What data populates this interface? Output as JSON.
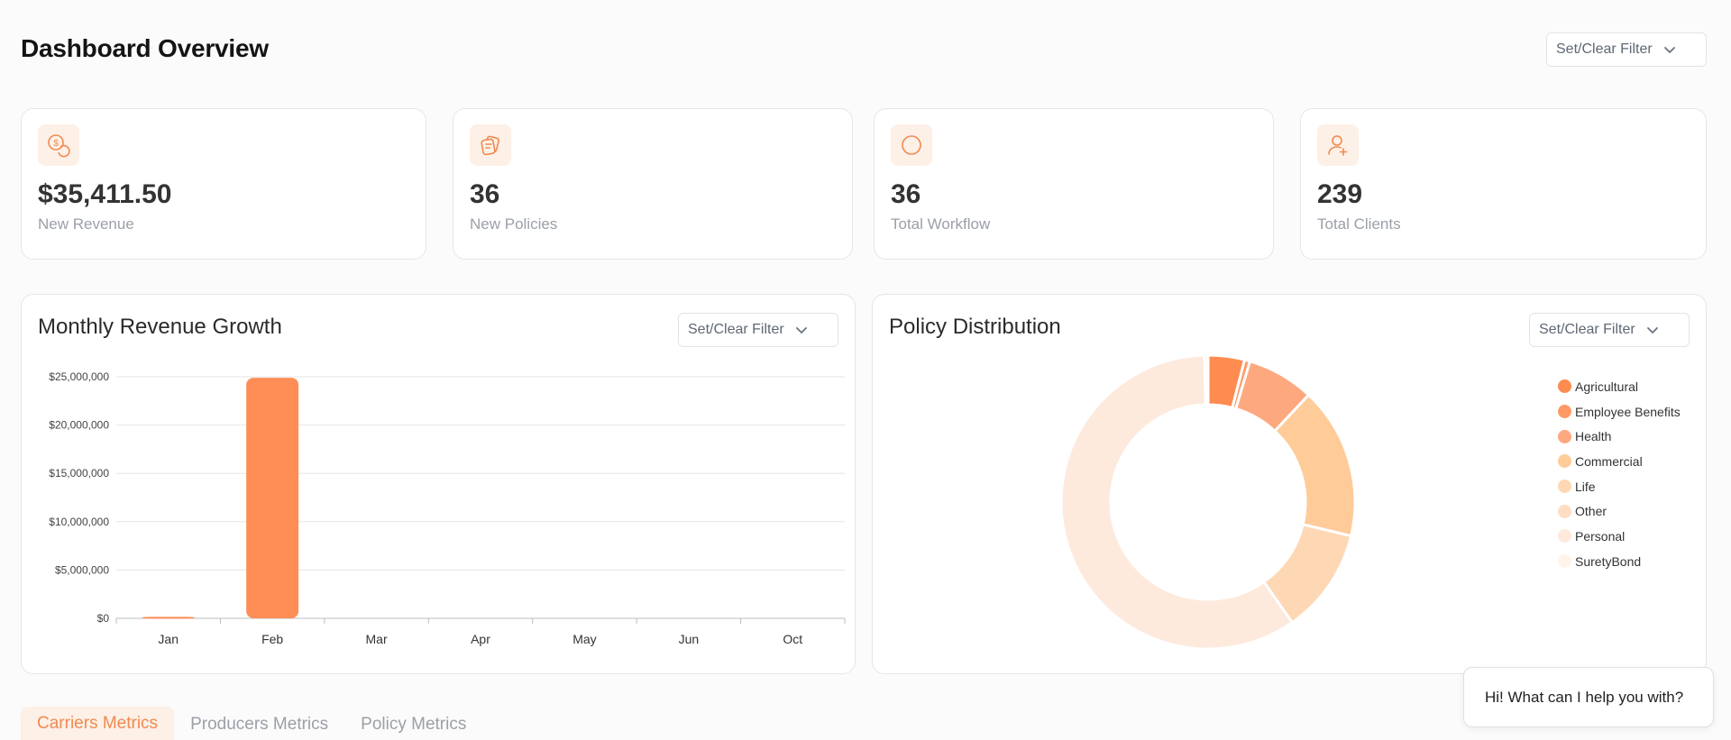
{
  "header": {
    "title": "Dashboard Overview",
    "filter_label": "Set/Clear Filter"
  },
  "stats": [
    {
      "value": "$35,411.50",
      "label": "New Revenue",
      "icon": "revenue-coins-icon"
    },
    {
      "value": "36",
      "label": "New Policies",
      "icon": "policies-icon"
    },
    {
      "value": "36",
      "label": "Total Workflow",
      "icon": "workflow-circle-icon"
    },
    {
      "value": "239",
      "label": "Total Clients",
      "icon": "add-user-icon"
    }
  ],
  "revenue_panel": {
    "title": "Monthly Revenue Growth",
    "filter_label": "Set/Clear Filter"
  },
  "policy_panel": {
    "title": "Policy Distribution",
    "filter_label": "Set/Clear Filter"
  },
  "tabs": [
    {
      "label": "Carriers Metrics",
      "active": true
    },
    {
      "label": "Producers Metrics",
      "active": false
    },
    {
      "label": "Policy Metrics",
      "active": false
    }
  ],
  "chat": {
    "message": "Hi! What can I help you with?"
  },
  "colors": {
    "accent": "#f08a50",
    "bar": "#fe8e55"
  },
  "chart_data": [
    {
      "type": "bar",
      "categories": [
        "Jan",
        "Feb",
        "Mar",
        "Apr",
        "May",
        "Jun",
        "Oct"
      ],
      "values": [
        150000,
        24900000,
        0,
        0,
        0,
        0,
        0
      ],
      "ylim": [
        0,
        25000000
      ],
      "yticks": [
        0,
        5000000,
        10000000,
        15000000,
        20000000,
        25000000
      ],
      "ytick_labels": [
        "$0",
        "$5,000,000",
        "$10,000,000",
        "$15,000,000",
        "$20,000,000",
        "$25,000,000"
      ],
      "grid": true
    },
    {
      "type": "pie",
      "donut": true,
      "labels": [
        "Agricultural",
        "Employee Benefits",
        "Health",
        "Commercial",
        "Life",
        "Other",
        "Personal",
        "SuretyBond"
      ],
      "values": [
        4.0,
        0.6,
        7.4,
        16.7,
        11.6,
        0,
        59.3,
        0.4
      ],
      "colors": [
        "#fe8b4f",
        "#fe9a67",
        "#fea880",
        "#fecb99",
        "#fed8b5",
        "#ffdcc4",
        "#feeadd",
        "#fff3ea"
      ],
      "legend": "right"
    }
  ]
}
